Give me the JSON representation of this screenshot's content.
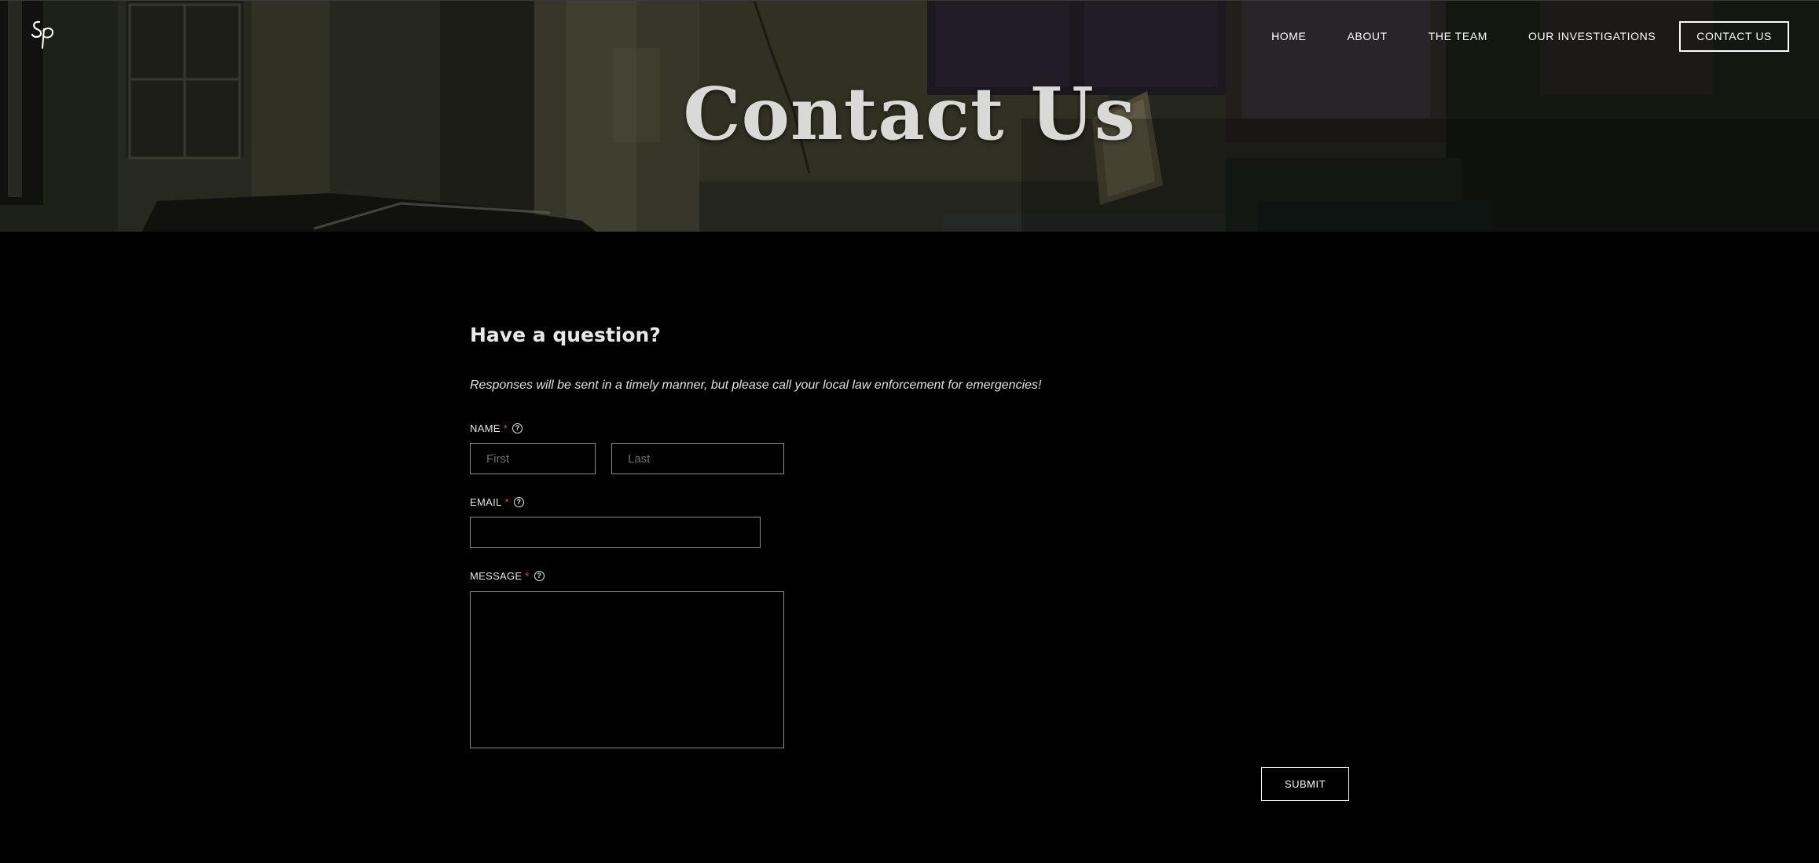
{
  "brand": {
    "logo_text": "Sp"
  },
  "nav": {
    "items": [
      "HOME",
      "ABOUT",
      "THE TEAM",
      "OUR INVESTIGATIONS"
    ],
    "cta": "CONTACT US"
  },
  "hero": {
    "title": "Contact Us"
  },
  "form": {
    "heading": "Have a question?",
    "subtext": "Responses will be sent in a timely manner, but please call your local law enforcement for emergencies!",
    "name": {
      "label": "NAME",
      "required_mark": "*",
      "first_placeholder": "First",
      "last_placeholder": "Last"
    },
    "email": {
      "label": "EMAIL",
      "required_mark": "*"
    },
    "message": {
      "label": "MESSAGE",
      "required_mark": "*"
    },
    "help_glyph": "?",
    "submit_label": "SUBMIT"
  },
  "colors": {
    "background": "#000000",
    "required": "#e04a4a",
    "text": "#ffffff"
  }
}
